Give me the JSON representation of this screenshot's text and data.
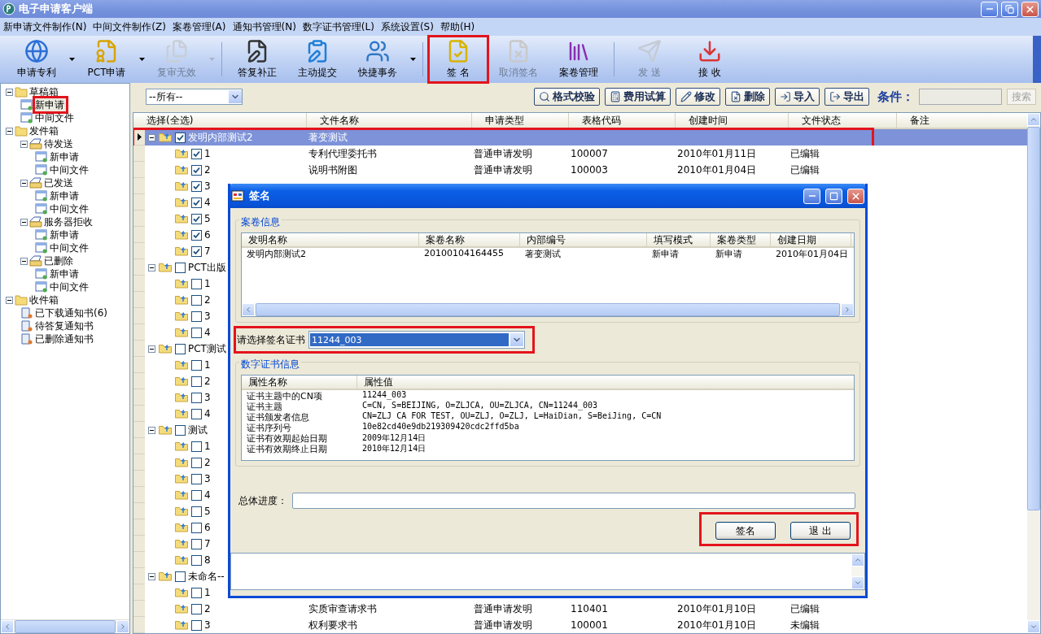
{
  "window": {
    "title": "电子申请客户端"
  },
  "menu": [
    "新申请文件制作(N)",
    "中间文件制作(Z)",
    "案卷管理(A)",
    "通知书管理(N)",
    "数字证书管理(L)",
    "系统设置(S)",
    "帮助(H)"
  ],
  "toolbar": [
    {
      "kind": "button",
      "label": "申请专利",
      "dropdown": true,
      "disabled": false,
      "highlighted": false
    },
    {
      "kind": "button",
      "label": "PCT申请",
      "dropdown": true,
      "disabled": false,
      "highlighted": false
    },
    {
      "kind": "button",
      "label": "复审无效",
      "dropdown": true,
      "disabled": true,
      "highlighted": false
    },
    {
      "kind": "separator"
    },
    {
      "kind": "button",
      "label": "答复补正",
      "dropdown": false,
      "disabled": false,
      "highlighted": false
    },
    {
      "kind": "button",
      "label": "主动提交",
      "dropdown": false,
      "disabled": false,
      "highlighted": false
    },
    {
      "kind": "button",
      "label": "快捷事务",
      "dropdown": true,
      "disabled": false,
      "highlighted": false
    },
    {
      "kind": "separator"
    },
    {
      "kind": "button",
      "label": "签 名",
      "dropdown": false,
      "disabled": false,
      "highlighted": true
    },
    {
      "kind": "button",
      "label": "取消签名",
      "dropdown": false,
      "disabled": true,
      "highlighted": false
    },
    {
      "kind": "button",
      "label": "案卷管理",
      "dropdown": false,
      "disabled": false,
      "highlighted": false
    },
    {
      "kind": "separator"
    },
    {
      "kind": "button",
      "label": "发 送",
      "dropdown": false,
      "disabled": true,
      "highlighted": false
    },
    {
      "kind": "button",
      "label": "接 收",
      "dropdown": false,
      "disabled": false,
      "highlighted": false
    }
  ],
  "tree": [
    {
      "kind": "folder",
      "label": "草稿箱",
      "expanded": true,
      "selected": false,
      "children": [
        {
          "kind": "doc",
          "label": "新申请",
          "selected": true,
          "highlighted": true
        },
        {
          "kind": "doc",
          "label": "中间文件",
          "selected": false,
          "highlighted": false
        }
      ]
    },
    {
      "kind": "folder",
      "label": "发件箱",
      "expanded": true,
      "selected": false,
      "children": [
        {
          "kind": "box",
          "label": "待发送",
          "expanded": true,
          "selected": false,
          "children": [
            {
              "kind": "doc",
              "label": "新申请",
              "selected": false,
              "highlighted": false
            },
            {
              "kind": "doc",
              "label": "中间文件",
              "selected": false,
              "highlighted": false
            }
          ]
        },
        {
          "kind": "box",
          "label": "已发送",
          "expanded": true,
          "selected": false,
          "children": [
            {
              "kind": "doc",
              "label": "新申请",
              "selected": false,
              "highlighted": false
            },
            {
              "kind": "doc",
              "label": "中间文件",
              "selected": false,
              "highlighted": false
            }
          ]
        },
        {
          "kind": "box",
          "label": "服务器拒收",
          "expanded": true,
          "selected": false,
          "children": [
            {
              "kind": "doc",
              "label": "新申请",
              "selected": false,
              "highlighted": false
            },
            {
              "kind": "doc",
              "label": "中间文件",
              "selected": false,
              "highlighted": false
            }
          ]
        },
        {
          "kind": "box",
          "label": "已删除",
          "expanded": true,
          "selected": false,
          "children": [
            {
              "kind": "doc",
              "label": "新申请",
              "selected": false,
              "highlighted": false
            },
            {
              "kind": "doc",
              "label": "中间文件",
              "selected": false,
              "highlighted": false
            }
          ]
        }
      ]
    },
    {
      "kind": "folder",
      "label": "收件箱",
      "expanded": true,
      "selected": false,
      "children": [
        {
          "kind": "notice",
          "label": "已下载通知书(6)",
          "selected": false,
          "highlighted": false
        },
        {
          "kind": "notice",
          "label": "待答复通知书",
          "selected": false,
          "highlighted": false
        },
        {
          "kind": "notice",
          "label": "已删除通知书",
          "selected": false,
          "highlighted": false
        }
      ]
    }
  ],
  "filter": {
    "scope": "--所有--",
    "actions": [
      "格式校验",
      "费用试算",
      "修改",
      "删除",
      "导入",
      "导出"
    ],
    "condition_label": "条件：",
    "search": "搜索"
  },
  "grid": {
    "columns": [
      "选择(全选)",
      "文件名称",
      "申请类型",
      "表格代码",
      "创建时间",
      "文件状态",
      "备注"
    ],
    "rows": [
      {
        "kind": "group",
        "label": "发明内部测试2",
        "checked": true,
        "selected": true,
        "highlighted": true,
        "cells": [
          "著变测试"
        ]
      },
      {
        "kind": "item",
        "label": "1",
        "checked": true,
        "selected": false,
        "cells": [
          "专利代理委托书",
          "普通申请发明",
          "100007",
          "2010年01月11日",
          "已编辑"
        ]
      },
      {
        "kind": "item",
        "label": "2",
        "checked": true,
        "selected": false,
        "cells": [
          "说明书附图",
          "普通申请发明",
          "100003",
          "2010年01月04日",
          "已编辑"
        ]
      },
      {
        "kind": "item",
        "label": "3",
        "checked": true,
        "selected": false
      },
      {
        "kind": "item",
        "label": "4",
        "checked": true,
        "selected": false
      },
      {
        "kind": "item",
        "label": "5",
        "checked": true,
        "selected": false
      },
      {
        "kind": "item",
        "label": "6",
        "checked": true,
        "selected": false
      },
      {
        "kind": "item",
        "label": "7",
        "checked": true,
        "selected": false
      },
      {
        "kind": "group",
        "label": "PCT出版",
        "checked": false,
        "selected": false,
        "highlighted": false
      },
      {
        "kind": "item",
        "label": "1",
        "checked": false,
        "selected": false
      },
      {
        "kind": "item",
        "label": "2",
        "checked": false,
        "selected": false
      },
      {
        "kind": "item",
        "label": "3",
        "checked": false,
        "selected": false
      },
      {
        "kind": "item",
        "label": "4",
        "checked": false,
        "selected": false
      },
      {
        "kind": "group",
        "label": "PCT测试",
        "checked": false,
        "selected": false,
        "highlighted": false
      },
      {
        "kind": "item",
        "label": "1",
        "checked": false,
        "selected": false
      },
      {
        "kind": "item",
        "label": "2",
        "checked": false,
        "selected": false
      },
      {
        "kind": "item",
        "label": "3",
        "checked": false,
        "selected": false
      },
      {
        "kind": "item",
        "label": "4",
        "checked": false,
        "selected": false
      },
      {
        "kind": "group",
        "label": "测试",
        "checked": false,
        "selected": false,
        "highlighted": false
      },
      {
        "kind": "item",
        "label": "1",
        "checked": false,
        "selected": false
      },
      {
        "kind": "item",
        "label": "2",
        "checked": false,
        "selected": false
      },
      {
        "kind": "item",
        "label": "3",
        "checked": false,
        "selected": false
      },
      {
        "kind": "item",
        "label": "4",
        "checked": false,
        "selected": false
      },
      {
        "kind": "item",
        "label": "5",
        "checked": false,
        "selected": false
      },
      {
        "kind": "item",
        "label": "6",
        "checked": false,
        "selected": false
      },
      {
        "kind": "item",
        "label": "7",
        "checked": false,
        "selected": false
      },
      {
        "kind": "item",
        "label": "8",
        "checked": false,
        "selected": false
      },
      {
        "kind": "group",
        "label": "未命名--",
        "checked": false,
        "selected": false,
        "highlighted": false
      },
      {
        "kind": "item",
        "label": "1",
        "checked": false,
        "selected": false
      },
      {
        "kind": "item",
        "label": "2",
        "checked": false,
        "selected": false,
        "cells": [
          "实质审查请求书",
          "普通申请发明",
          "110401",
          "2010年01月10日",
          "已编辑"
        ]
      },
      {
        "kind": "item",
        "label": "3",
        "checked": false,
        "selected": false,
        "cells": [
          "权利要求书",
          "普通申请发明",
          "100001",
          "2010年01月10日",
          "未编辑"
        ]
      }
    ]
  },
  "dialog": {
    "title": "签名",
    "case_group": {
      "title": "案卷信息",
      "columns": [
        "发明名称",
        "案卷名称",
        "内部编号",
        "填写模式",
        "案卷类型",
        "创建日期"
      ],
      "rows": [
        [
          "发明内部测试2",
          "20100104164455",
          "著变测试",
          "新申请",
          "新申请",
          "2010年01月04日"
        ]
      ]
    },
    "cert_select": {
      "label": "请选择签名证书",
      "value": "11244_003",
      "highlighted": true
    },
    "cert_group": {
      "title": "数字证书信息",
      "columns": [
        "属性名称",
        "属性值"
      ],
      "rows": [
        [
          "证书主题中的CN项",
          "11244_003"
        ],
        [
          "证书主题",
          "C=CN, S=BEIJING, O=ZLJCA, OU=ZLJCA, CN=11244_003"
        ],
        [
          "证书颁发者信息",
          "CN=ZLJ CA FOR TEST, OU=ZLJ, O=ZLJ, L=HaiDian, S=BeiJing, C=CN"
        ],
        [
          "证书序列号",
          "10e82cd40e9db219309420cdc2ffd5ba"
        ],
        [
          "证书有效期起始日期",
          "2009年12月14日"
        ],
        [
          "证书有效期终止日期",
          "2010年12月14日"
        ]
      ]
    },
    "progress": {
      "label": "总体进度：",
      "level": 0
    },
    "buttons": [
      "签名",
      "退 出"
    ],
    "buttons_highlighted": true
  }
}
